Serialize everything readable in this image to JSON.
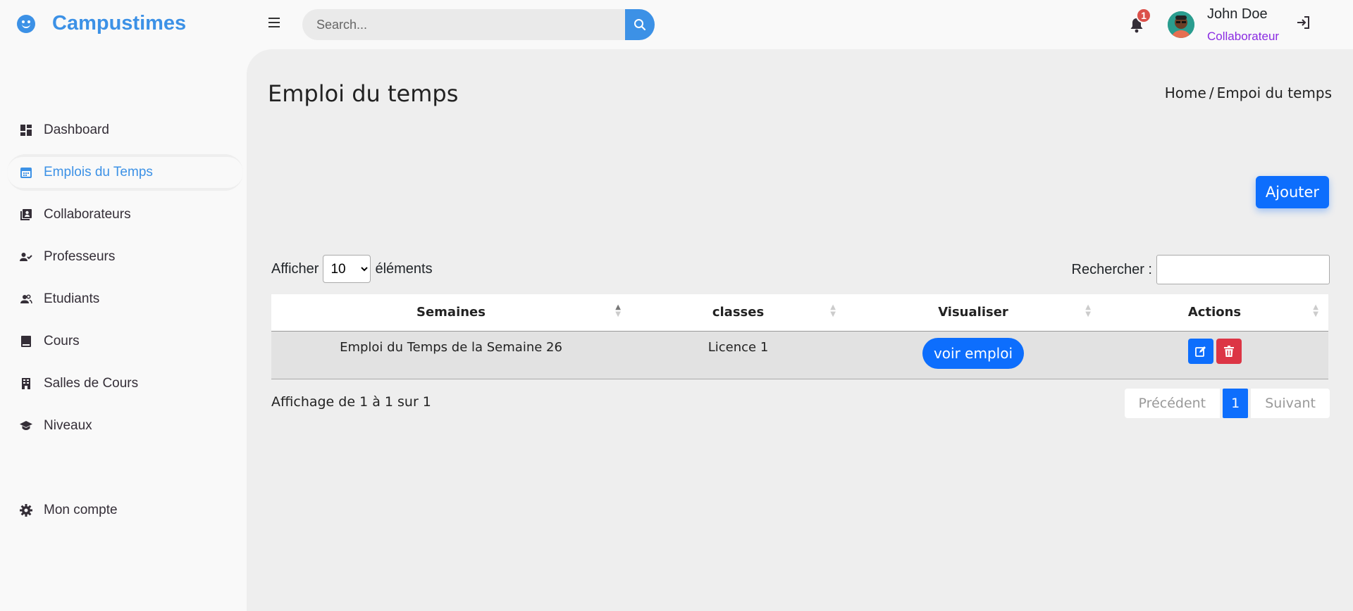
{
  "brand": {
    "name": "Campustimes"
  },
  "search": {
    "placeholder": "Search..."
  },
  "notifications": {
    "count": "1"
  },
  "user": {
    "name": "John Doe",
    "role": "Collaborateur"
  },
  "sidebar": {
    "items": [
      {
        "label": "Dashboard",
        "icon": "dashboard-icon"
      },
      {
        "label": "Emplois du Temps",
        "icon": "calendar-icon",
        "active": true
      },
      {
        "label": "Collaborateurs",
        "icon": "contacts-icon"
      },
      {
        "label": "Professeurs",
        "icon": "user-check-icon"
      },
      {
        "label": "Etudiants",
        "icon": "users-icon"
      },
      {
        "label": "Cours",
        "icon": "book-icon"
      },
      {
        "label": "Salles de Cours",
        "icon": "building-icon"
      },
      {
        "label": "Niveaux",
        "icon": "graduation-cap-icon"
      }
    ],
    "account": {
      "label": "Mon compte",
      "icon": "gear-icon"
    }
  },
  "page": {
    "title": "Emploi du temps",
    "breadcrumb": {
      "home": "Home",
      "sep": "/",
      "current": "Empoi du temps"
    },
    "add_label": "Ajouter"
  },
  "table": {
    "length": {
      "prefix": "Afficher",
      "value": "10",
      "options": [
        "10"
      ],
      "suffix": "éléments"
    },
    "filter": {
      "label": "Rechercher :",
      "value": ""
    },
    "columns": [
      "Semaines",
      "classes",
      "Visualiser",
      "Actions"
    ],
    "rows": [
      {
        "semaine": "Emploi du Temps de la Semaine 26",
        "classe": "Licence 1",
        "voir_label": "voir emploi"
      }
    ],
    "info": "Affichage de 1 à 1 sur 1",
    "pager": {
      "prev": "Précédent",
      "current": "1",
      "next": "Suivant"
    }
  },
  "colors": {
    "accent": "#3c91e6",
    "primary": "#0d6efd",
    "danger": "#dc3545",
    "role": "#8a2be2"
  }
}
